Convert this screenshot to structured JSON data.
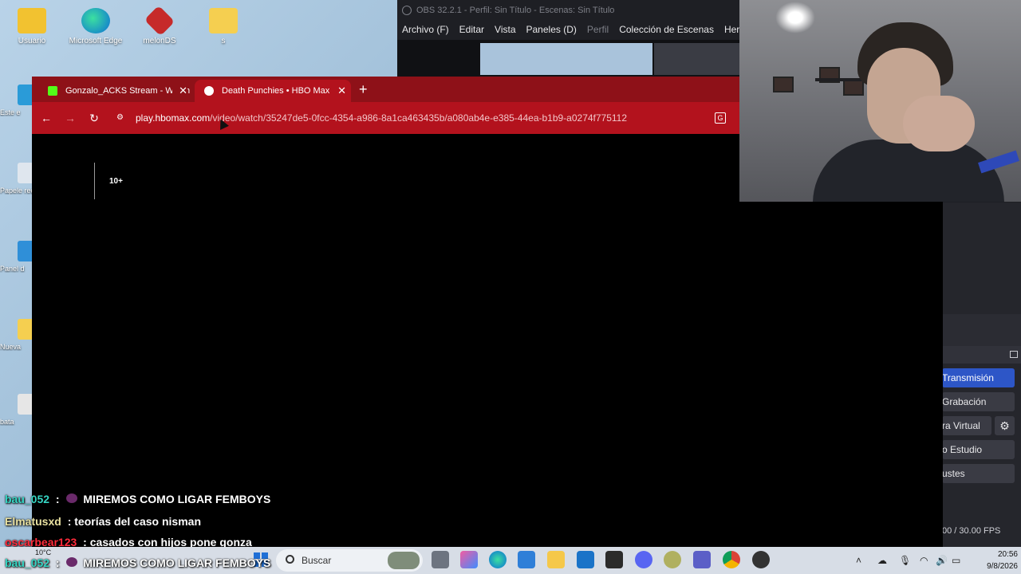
{
  "desktop": {
    "icons": [
      {
        "label": "Usuario"
      },
      {
        "label": "Microsoft Edge"
      },
      {
        "label": "melonDS"
      },
      {
        "label": "s"
      }
    ],
    "left_strip": [
      "Este e",
      "Papele recic",
      "Panel d",
      "Nueva",
      "bata"
    ]
  },
  "obs": {
    "title": "OBS 32.2.1 - Perfil: Sin Título - Escenas: Sin Título",
    "menu": [
      "Archivo (F)",
      "Editar",
      "Vista",
      "Paneles (D)",
      "Perfil",
      "Colección de Escenas",
      "Herramientas"
    ],
    "controls": {
      "stream": "Transmisión",
      "record": "Grabación",
      "virtual_cam": "ra Virtual",
      "studio": "o Estudio",
      "settings": "ustes"
    },
    "stats": "00 / 30.00 FPS"
  },
  "browser": {
    "tabs": [
      {
        "title": "Gonzalo_ACKS Stream - Watch Live on Kick",
        "active": false
      },
      {
        "title": "Death Punchies • HBO Max",
        "active": true
      }
    ],
    "url_host": "play.hbomax.com",
    "url_path": "/video/watch/35247de5-0fcc-4354-a986-8a1ca463435b/a080ab4e-e385-44ea-b1b9-a0274f775112",
    "rating": "10+"
  },
  "chat": [
    {
      "user": "bau_052",
      "user_color": "#36d6c4",
      "sep": " :",
      "message": "MIREMOS COMO LIGAR FEMBOYS",
      "emote": true
    },
    {
      "user": "Elmatusxd",
      "user_color": "#e8e0a0",
      "sep": " :",
      "message": "teorías del caso nisman",
      "emote": false
    },
    {
      "user": "oscarbear123",
      "user_color": "#ff2a3a",
      "sep": " :",
      "message": "casados con hijos pone gonza",
      "emote": false
    },
    {
      "user": "bau_052",
      "user_color": "#36d6c4",
      "sep": " :",
      "message": "MIREMOS COMO LIGAR FEMBOYS",
      "emote": true
    }
  ],
  "taskbar": {
    "weather": "10°C",
    "search_placeholder": "Buscar",
    "clock_time": "20:56",
    "clock_date": "9/8/2026",
    "apps": [
      "task-view",
      "copilot",
      "edge",
      "store",
      "file-explorer",
      "outlook",
      "live",
      "discord",
      "game",
      "teams",
      "chrome",
      "obs"
    ]
  }
}
